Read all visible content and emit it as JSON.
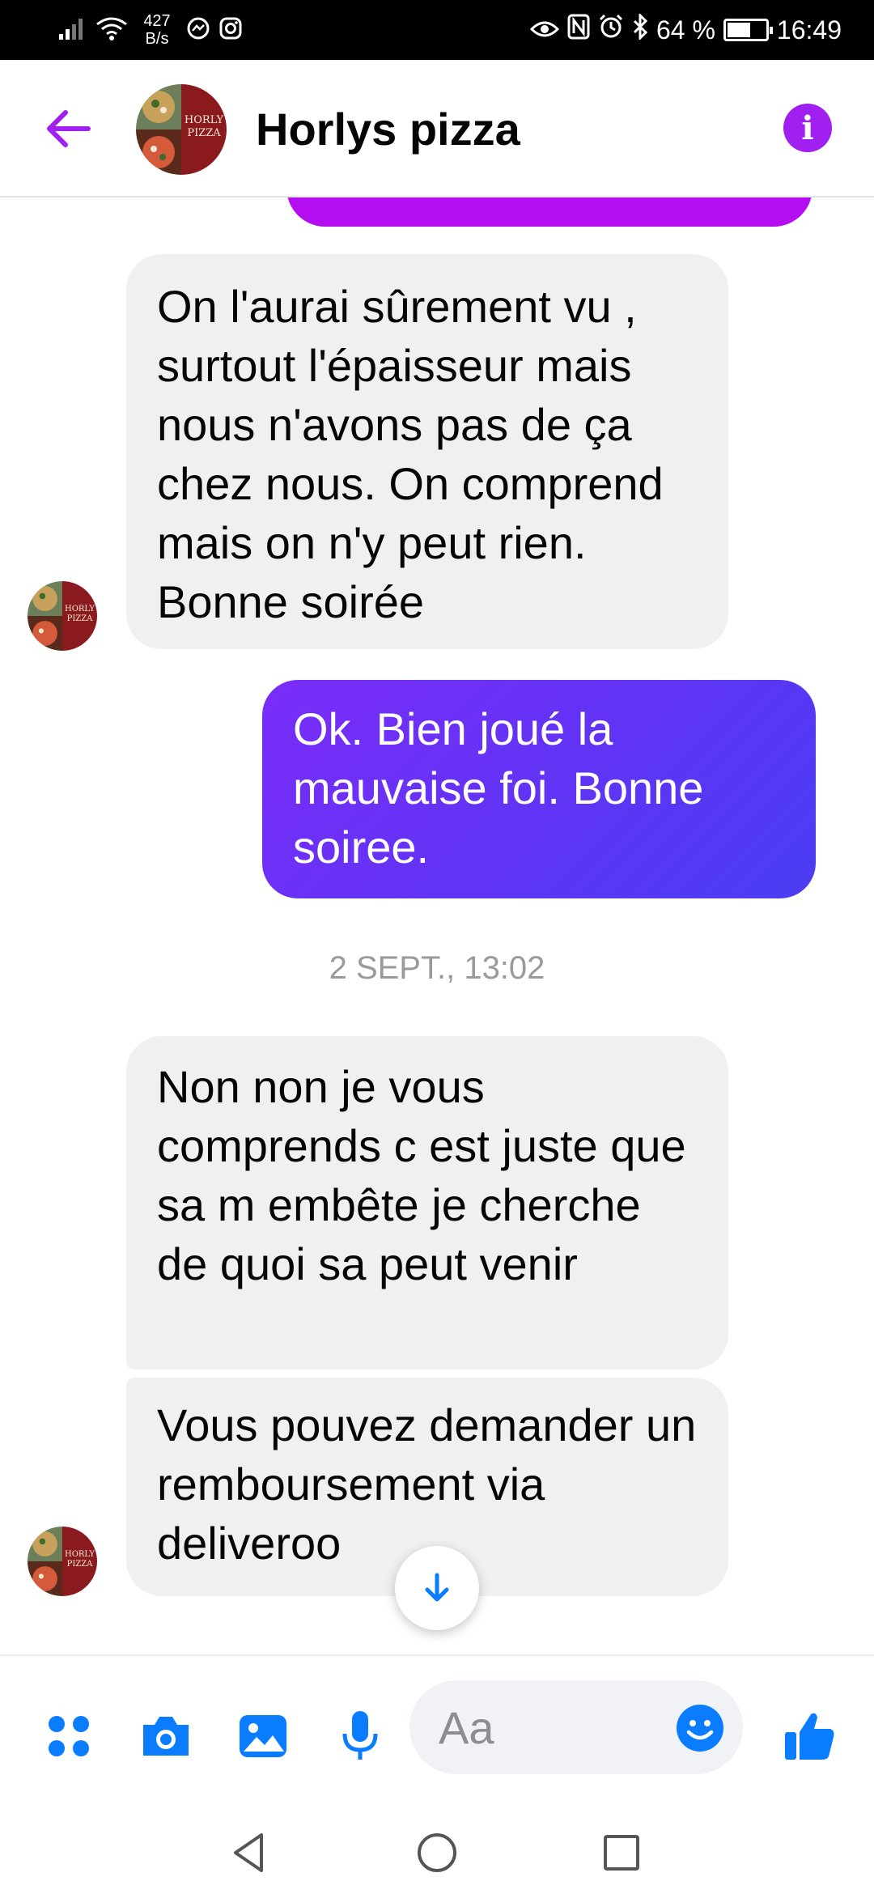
{
  "status_bar": {
    "net_speed_value": "427",
    "net_speed_unit": "B/s",
    "battery": "64 %",
    "battery_level": 0.64,
    "time": "16:49"
  },
  "header": {
    "contact_name": "Horlys pizza",
    "back_icon": "arrow-left-icon",
    "info_icon": "info-icon",
    "accent_color": "#a020f0"
  },
  "avatar": {
    "brand_line1": "HORLY",
    "brand_line2": "PIZZA"
  },
  "messages": [
    {
      "direction": "incoming",
      "text": "On l'aurai sûrement vu , surtout l'épaisseur mais nous n'avons pas de ça chez nous. On comprend mais on n'y peut rien. Bonne soirée"
    },
    {
      "direction": "outgoing",
      "text": "Ok. Bien joué la mauvaise foi. Bonne soiree."
    },
    {
      "direction": "incoming",
      "text": "Non non je vous comprends c est juste que sa m embête je cherche de quoi sa peut venir"
    },
    {
      "direction": "incoming",
      "text": "Vous pouvez demander un remboursement via deliveroo"
    }
  ],
  "timestamp": "2 SEPT., 13:02",
  "composer": {
    "placeholder": "Aa",
    "icons": [
      "apps-icon",
      "camera-icon",
      "gallery-icon",
      "microphone-icon",
      "emoji-icon",
      "thumbs-up-icon"
    ],
    "icon_color": "#0a7cff"
  },
  "colors": {
    "incoming_bubble": "#f0f0f0",
    "outgoing_bubble_start": "#7a2cf8",
    "outgoing_bubble_end": "#4a3ef3"
  }
}
